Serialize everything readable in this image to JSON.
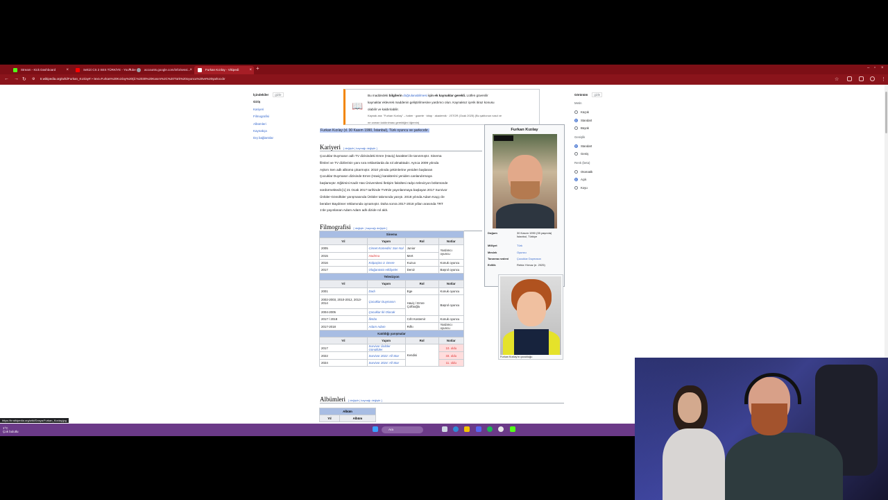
{
  "browser": {
    "tabs": [
      {
        "label": "Stream - Kick Dashboard",
        "color": "#53fc18"
      },
      {
        "label": "Sekizi CS 2 SES TÜRKİYE - YouTube",
        "color": "#ff0000"
      },
      {
        "label": "accounts.google.com/info/sessi...",
        "color": "#9aa0a6"
      },
      {
        "label": "Furkan Kızılay - Vikipedi",
        "color": "#ffffff"
      }
    ],
    "new_tab": "+",
    "url_domain": "tr.wikipedia.org",
    "url_path": "/wiki/Furkan_Kızılay#:~:text=Furkan%20Kızılay%20(d.%2030%20Kasım%2C%20Türk%20oyuncu%20ve%20şarkıcıdır"
  },
  "toc": {
    "title": "İçindekiler",
    "hide": "gizle",
    "items": [
      "Giriş",
      "Kariyeri",
      "Filmografisi",
      "Albümleri",
      "Kaynakça",
      "Dış bağlantılar"
    ]
  },
  "notice": {
    "line1_pre": "Bu maddedeki ",
    "line1_bold": "bilgilerin ",
    "line1_link": "doğrulanabilmesi",
    "line1_post": " için ek kaynaklar gerekli.",
    "line1_rest": " Lütfen güvenilir",
    "line2": "kaynaklar eklevrek maddenin geliştirilmesine yardımcı olun. Kaynaksız içerik itiraz konusu",
    "line3": "olabilir ve kaldırılabilir.",
    "line4": "Kaynak ara: \"Furkan Kızılay\" – haber · gazete · kitap · akademik · JSTOR (Ocak 2025) (Bu şablonun nasıl ve",
    "line5": "ne zaman kaldırılması gerektiğini öğrenin)"
  },
  "lead": "Furkan Kızılay (d. 30 Kasım 1990, İstanbul), Türk oyuncu ve şarkıcıdır.",
  "sections": {
    "career": "Kariyeri",
    "filmography": "Filmografisi",
    "albums": "Albümleri",
    "edit_links": "[ değiştir | kaynağı değiştir ]"
  },
  "career_text": [
    "Çocuklar Duymasın adlı TV dizisindeki Emre (Haviç) karakteri ile tanınmıştır. Sinema",
    "filmleri ve TV dizilerinin yanı sıra reklamlarda da rol almaktadır. Ayrıca 2009 yılında",
    "Aşkım Sen adlı albümü çıkarmıştır. 2010 yılında çekimlerine yeniden başlanan",
    "Çocuklar Duymasın dizisinde Emre (Haviç) karakterini yeniden canlandırmaya",
    "başlamıştır. Eğitimini Kadir Has Üniversitesi İletişim fakültesi radyo televizyon bölümünde",
    "sürdürmektedir.[1] 21 Ocak 2017 tarihinde TV8'de yayınlanmaya başlayan 2017 Survivor",
    "Ünlüler-Gönüllüler yarışmasında Ünlüler takımında yarıştı. 2018 yılında Adam Kaççı ile",
    "beraber Baydöner reklamında oynamıştır. Daha sonra 2017-2018 yılları arasında TRT",
    "1'de yayınlanan Adam Adam adlı dizide rol aldı."
  ],
  "infobox": {
    "title": "Furkan Kızılay",
    "rows": [
      {
        "k": "Doğum",
        "v": "30 Kasım 1990 (35 yaşında) İstanbul, Türkiye"
      },
      {
        "k": "Milliyet",
        "v": "Türk"
      },
      {
        "k": "Meslek",
        "v": "Oyuncu"
      },
      {
        "k": "Tanınma nedeni",
        "v": "Çocuklar Duymasın"
      },
      {
        "k": "Evlilik",
        "v": "Rebia Yılmaz (e. 2025)"
      }
    ],
    "caption2": "Furkan Kızılay'ın çocukluğu"
  },
  "filmography": {
    "sinema_title": "Sinema",
    "tv_title": "Televizyon",
    "contest_title": "Katıldığı yarışmalar",
    "headers": [
      "Yıl",
      "Yapım",
      "Rol",
      "Notlar"
    ],
    "sinema": [
      [
        "2005",
        "Cinnet Komedisi: Son Nal",
        "Junior",
        "Yardımcı oyuncu"
      ],
      [
        "2015",
        "Hadrma",
        "Mert",
        ""
      ],
      [
        "2016",
        "Kolpaçino 3. Devre",
        "Kuzuo",
        "Konuk oyuncu"
      ],
      [
        "2017",
        "Olağanüstü Hikâyeler",
        "Deniz",
        "Başrol oyuncu"
      ]
    ],
    "tv": [
      [
        "2001",
        "Dadı",
        "Ege",
        "Konuk oyuncu"
      ],
      [
        "2002-2003, 2010-2012, 2013-2014",
        "Çocuklar Duymasın",
        "Haviç / Emre Çolfaoğlu",
        "Başrol oyuncu"
      ],
      [
        "2004-2005",
        "Çocuklar İki Olacak",
        "",
        ""
      ],
      [
        "2017 / 2018",
        "İlimbo",
        "Cıfıt Kostemir",
        "Konuk oyuncu"
      ],
      [
        "2017-2018",
        "Adam Adam",
        "Rıfkı",
        "Yardımcı oyuncu"
      ]
    ],
    "contests": [
      [
        "2017",
        "Survivor Ünlüler Gönüllüler",
        "",
        "10. oldu"
      ],
      [
        "2022",
        "Survivor 2022: All Star",
        "Kendisi",
        "33. oldu"
      ],
      [
        "2024",
        "Survivor 2024: All Star",
        "",
        "11. oldu"
      ]
    ]
  },
  "album": {
    "title": "Albüm",
    "col1": "Yıl",
    "col2": "Albüm"
  },
  "appearance": {
    "title": "Görünüm",
    "hide": "gizle",
    "text_label": "Metin",
    "text_opts": [
      "Küçük",
      "Standart",
      "Büyük"
    ],
    "width_label": "Genişlik",
    "width_opts": [
      "Standart",
      "Geniş"
    ],
    "color_label": "Renk (beta)",
    "color_opts": [
      "Otomatik",
      "Açık",
      "Koyu"
    ]
  },
  "status_url": "https://tr.wikipedia.org/wiki/Dosya:Furkan_Kızılay.jpg",
  "taskbar": {
    "weather_temp": "1°C",
    "weather_desc": "Çok bulutlu",
    "search": "Ara"
  }
}
